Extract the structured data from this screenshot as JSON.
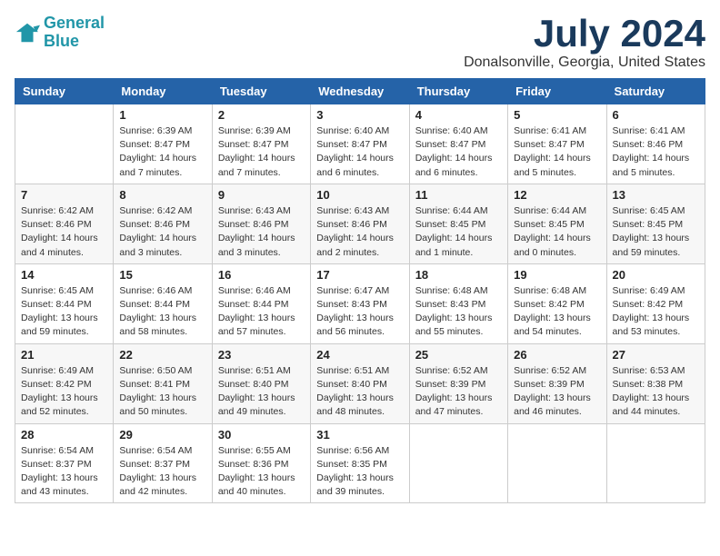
{
  "logo": {
    "line1": "General",
    "line2": "Blue"
  },
  "title": "July 2024",
  "location": "Donalsonville, Georgia, United States",
  "days_of_week": [
    "Sunday",
    "Monday",
    "Tuesday",
    "Wednesday",
    "Thursday",
    "Friday",
    "Saturday"
  ],
  "weeks": [
    [
      {
        "day": "",
        "info": ""
      },
      {
        "day": "1",
        "info": "Sunrise: 6:39 AM\nSunset: 8:47 PM\nDaylight: 14 hours\nand 7 minutes."
      },
      {
        "day": "2",
        "info": "Sunrise: 6:39 AM\nSunset: 8:47 PM\nDaylight: 14 hours\nand 7 minutes."
      },
      {
        "day": "3",
        "info": "Sunrise: 6:40 AM\nSunset: 8:47 PM\nDaylight: 14 hours\nand 6 minutes."
      },
      {
        "day": "4",
        "info": "Sunrise: 6:40 AM\nSunset: 8:47 PM\nDaylight: 14 hours\nand 6 minutes."
      },
      {
        "day": "5",
        "info": "Sunrise: 6:41 AM\nSunset: 8:47 PM\nDaylight: 14 hours\nand 5 minutes."
      },
      {
        "day": "6",
        "info": "Sunrise: 6:41 AM\nSunset: 8:46 PM\nDaylight: 14 hours\nand 5 minutes."
      }
    ],
    [
      {
        "day": "7",
        "info": "Sunrise: 6:42 AM\nSunset: 8:46 PM\nDaylight: 14 hours\nand 4 minutes."
      },
      {
        "day": "8",
        "info": "Sunrise: 6:42 AM\nSunset: 8:46 PM\nDaylight: 14 hours\nand 3 minutes."
      },
      {
        "day": "9",
        "info": "Sunrise: 6:43 AM\nSunset: 8:46 PM\nDaylight: 14 hours\nand 3 minutes."
      },
      {
        "day": "10",
        "info": "Sunrise: 6:43 AM\nSunset: 8:46 PM\nDaylight: 14 hours\nand 2 minutes."
      },
      {
        "day": "11",
        "info": "Sunrise: 6:44 AM\nSunset: 8:45 PM\nDaylight: 14 hours\nand 1 minute."
      },
      {
        "day": "12",
        "info": "Sunrise: 6:44 AM\nSunset: 8:45 PM\nDaylight: 14 hours\nand 0 minutes."
      },
      {
        "day": "13",
        "info": "Sunrise: 6:45 AM\nSunset: 8:45 PM\nDaylight: 13 hours\nand 59 minutes."
      }
    ],
    [
      {
        "day": "14",
        "info": "Sunrise: 6:45 AM\nSunset: 8:44 PM\nDaylight: 13 hours\nand 59 minutes."
      },
      {
        "day": "15",
        "info": "Sunrise: 6:46 AM\nSunset: 8:44 PM\nDaylight: 13 hours\nand 58 minutes."
      },
      {
        "day": "16",
        "info": "Sunrise: 6:46 AM\nSunset: 8:44 PM\nDaylight: 13 hours\nand 57 minutes."
      },
      {
        "day": "17",
        "info": "Sunrise: 6:47 AM\nSunset: 8:43 PM\nDaylight: 13 hours\nand 56 minutes."
      },
      {
        "day": "18",
        "info": "Sunrise: 6:48 AM\nSunset: 8:43 PM\nDaylight: 13 hours\nand 55 minutes."
      },
      {
        "day": "19",
        "info": "Sunrise: 6:48 AM\nSunset: 8:42 PM\nDaylight: 13 hours\nand 54 minutes."
      },
      {
        "day": "20",
        "info": "Sunrise: 6:49 AM\nSunset: 8:42 PM\nDaylight: 13 hours\nand 53 minutes."
      }
    ],
    [
      {
        "day": "21",
        "info": "Sunrise: 6:49 AM\nSunset: 8:42 PM\nDaylight: 13 hours\nand 52 minutes."
      },
      {
        "day": "22",
        "info": "Sunrise: 6:50 AM\nSunset: 8:41 PM\nDaylight: 13 hours\nand 50 minutes."
      },
      {
        "day": "23",
        "info": "Sunrise: 6:51 AM\nSunset: 8:40 PM\nDaylight: 13 hours\nand 49 minutes."
      },
      {
        "day": "24",
        "info": "Sunrise: 6:51 AM\nSunset: 8:40 PM\nDaylight: 13 hours\nand 48 minutes."
      },
      {
        "day": "25",
        "info": "Sunrise: 6:52 AM\nSunset: 8:39 PM\nDaylight: 13 hours\nand 47 minutes."
      },
      {
        "day": "26",
        "info": "Sunrise: 6:52 AM\nSunset: 8:39 PM\nDaylight: 13 hours\nand 46 minutes."
      },
      {
        "day": "27",
        "info": "Sunrise: 6:53 AM\nSunset: 8:38 PM\nDaylight: 13 hours\nand 44 minutes."
      }
    ],
    [
      {
        "day": "28",
        "info": "Sunrise: 6:54 AM\nSunset: 8:37 PM\nDaylight: 13 hours\nand 43 minutes."
      },
      {
        "day": "29",
        "info": "Sunrise: 6:54 AM\nSunset: 8:37 PM\nDaylight: 13 hours\nand 42 minutes."
      },
      {
        "day": "30",
        "info": "Sunrise: 6:55 AM\nSunset: 8:36 PM\nDaylight: 13 hours\nand 40 minutes."
      },
      {
        "day": "31",
        "info": "Sunrise: 6:56 AM\nSunset: 8:35 PM\nDaylight: 13 hours\nand 39 minutes."
      },
      {
        "day": "",
        "info": ""
      },
      {
        "day": "",
        "info": ""
      },
      {
        "day": "",
        "info": ""
      }
    ]
  ]
}
